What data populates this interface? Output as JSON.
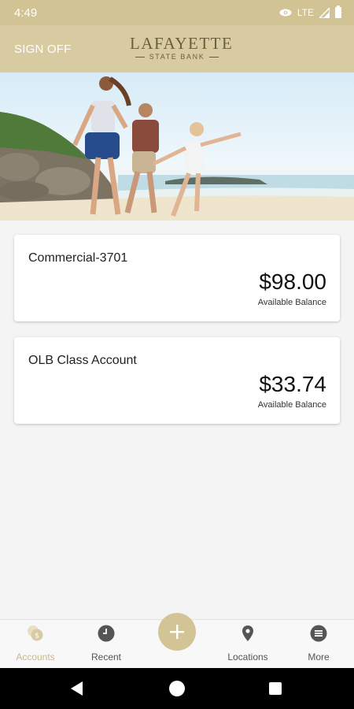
{
  "status_bar": {
    "time": "4:49",
    "network": "LTE"
  },
  "header": {
    "sign_off_label": "SIGN OFF",
    "logo_main": "LAFAYETTE",
    "logo_sub": "STATE BANK"
  },
  "accounts": [
    {
      "name": "Commercial-3701",
      "balance": "$98.00",
      "balance_label": "Available Balance"
    },
    {
      "name": "OLB Class Account",
      "balance": "$33.74",
      "balance_label": "Available Balance"
    }
  ],
  "bottom_nav": {
    "items": [
      {
        "label": "Accounts",
        "icon": "coins-icon",
        "active": true
      },
      {
        "label": "Recent",
        "icon": "clock-icon",
        "active": false
      },
      {
        "label": "Locations",
        "icon": "map-pin-icon",
        "active": false
      },
      {
        "label": "More",
        "icon": "more-icon",
        "active": false
      }
    ],
    "fab_icon": "plus-icon"
  },
  "colors": {
    "brand": "#d8cba1",
    "status_bar": "#d2c394",
    "fab": "#d3c496",
    "active_nav": "#c9b98a"
  }
}
